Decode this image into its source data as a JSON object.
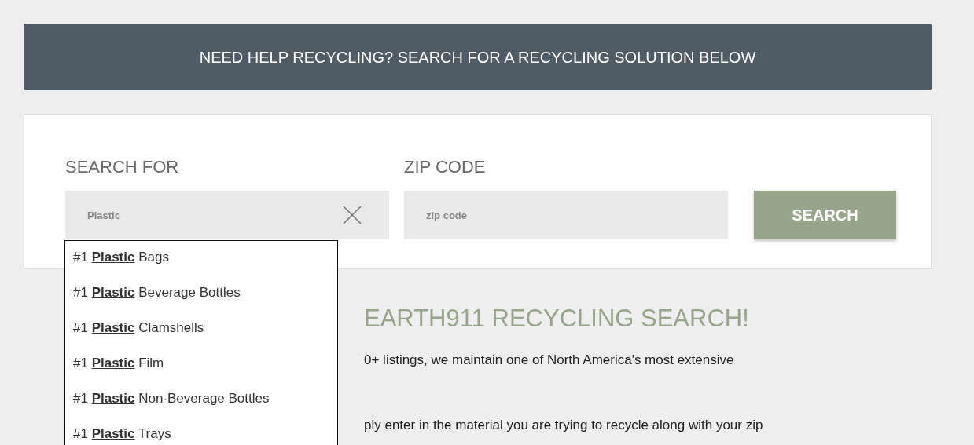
{
  "banner": {
    "text": "NEED HELP RECYCLING? SEARCH FOR A RECYCLING SOLUTION BELOW"
  },
  "search_form": {
    "search_label": "SEARCH FOR",
    "search_value": "Plastic",
    "zip_label": "ZIP CODE",
    "zip_placeholder": "zip code",
    "button": "SEARCH"
  },
  "suggestions": [
    {
      "prefix": "#1",
      "match": "Plastic",
      "suffix": "Bags"
    },
    {
      "prefix": "#1",
      "match": "Plastic",
      "suffix": "Beverage Bottles"
    },
    {
      "prefix": "#1",
      "match": "Plastic",
      "suffix": "Clamshells"
    },
    {
      "prefix": "#1",
      "match": "Plastic",
      "suffix": "Film"
    },
    {
      "prefix": "#1",
      "match": "Plastic",
      "suffix": "Non-Beverage Bottles"
    },
    {
      "prefix": "#1",
      "match": "Plastic",
      "suffix": "Trays"
    }
  ],
  "intro": {
    "heading": "EARTH911 RECYCLING SEARCH!",
    "lines": [
      "0+ listings, we maintain one of North America's most extensive",
      "ply enter in the material you are trying to recycle along with your zip"
    ]
  }
}
